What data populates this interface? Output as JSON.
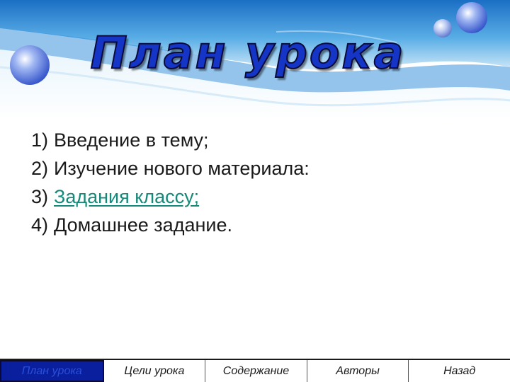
{
  "slide": {
    "title": "План урока"
  },
  "plan": {
    "items": [
      {
        "num": "1)",
        "text": "Введение в тему;",
        "is_link": false
      },
      {
        "num": "2)",
        "text": "Изучение нового материала:",
        "is_link": false
      },
      {
        "num": "3)",
        "text": "Задания классу;",
        "is_link": true
      },
      {
        "num": "4)",
        "text": "Домашнее задание.",
        "is_link": false
      }
    ]
  },
  "nav": {
    "items": [
      {
        "label": "План урока",
        "active": true
      },
      {
        "label": "Цели урока",
        "active": false
      },
      {
        "label": "Содержание",
        "active": false
      },
      {
        "label": "Авторы",
        "active": false
      },
      {
        "label": "Назад",
        "active": false
      }
    ]
  },
  "colors": {
    "title_fill": "#1535c6",
    "link": "#168a7a",
    "nav_active_bg": "#0a1f9e",
    "wave_light": "#e6f3fb",
    "wave_dark": "#1f7fd0"
  }
}
